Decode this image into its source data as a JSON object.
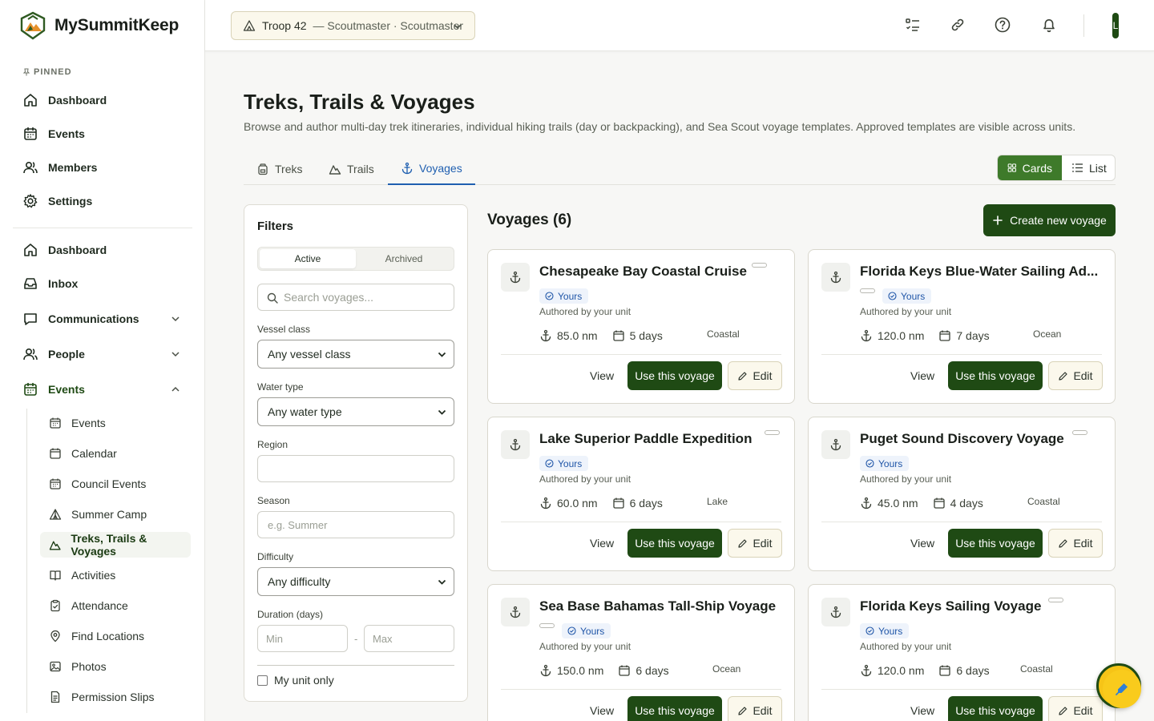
{
  "brand": {
    "name": "MySummitKeep"
  },
  "sidebar": {
    "pinned_label": "PINNED",
    "pinned": [
      {
        "label": "Dashboard",
        "icon": "home-icon"
      },
      {
        "label": "Events",
        "icon": "calendar-icon"
      },
      {
        "label": "Members",
        "icon": "users-icon"
      },
      {
        "label": "Settings",
        "icon": "gear-icon"
      }
    ],
    "main": [
      {
        "label": "Dashboard",
        "icon": "home-icon"
      },
      {
        "label": "Inbox",
        "icon": "inbox-icon"
      },
      {
        "label": "Communications",
        "icon": "message-icon",
        "expandable": true
      },
      {
        "label": "People",
        "icon": "users-icon",
        "expandable": true
      },
      {
        "label": "Events",
        "icon": "calendar-icon",
        "expanded": true
      }
    ],
    "event_sub": [
      {
        "label": "Events",
        "icon": "calendar-grid-icon"
      },
      {
        "label": "Calendar",
        "icon": "calendar-icon"
      },
      {
        "label": "Council Events",
        "icon": "calendar-grid-icon"
      },
      {
        "label": "Summer Camp",
        "icon": "tent-icon"
      },
      {
        "label": "Treks, Trails & Voyages",
        "icon": "mountain-icon",
        "active": true
      },
      {
        "label": "Activities",
        "icon": "book-icon"
      },
      {
        "label": "Attendance",
        "icon": "clipboard-icon"
      },
      {
        "label": "Find Locations",
        "icon": "map-pin-icon"
      },
      {
        "label": "Photos",
        "icon": "image-icon"
      },
      {
        "label": "Permission Slips",
        "icon": "document-icon"
      }
    ]
  },
  "topbar": {
    "troop_name": "Troop 42",
    "troop_role": "— Scoutmaster · Scoutmaster",
    "avatar_initial": "L"
  },
  "page": {
    "title": "Treks, Trails & Voyages",
    "description": "Browse and author multi-day trek itineraries, individual hiking trails (day or backpacking), and Sea Scout voyage templates. Approved templates are visible across units."
  },
  "tabs": [
    {
      "label": "Treks",
      "icon": "backpack-icon"
    },
    {
      "label": "Trails",
      "icon": "mountain-icon"
    },
    {
      "label": "Voyages",
      "icon": "anchor-icon",
      "active": true
    }
  ],
  "view_toggle": {
    "cards": "Cards",
    "list": "List",
    "selected": "Cards"
  },
  "filters": {
    "title": "Filters",
    "segment": {
      "active": "Active",
      "archived": "Archived",
      "selected": "Active"
    },
    "search_placeholder": "Search voyages...",
    "vessel_class_label": "Vessel class",
    "vessel_class_value": "Any vessel class",
    "water_type_label": "Water type",
    "water_type_value": "Any water type",
    "region_label": "Region",
    "region_value": "",
    "season_label": "Season",
    "season_placeholder": "e.g. Summer",
    "difficulty_label": "Difficulty",
    "difficulty_value": "Any difficulty",
    "duration_label": "Duration (days)",
    "min_placeholder": "Min",
    "dash": "-",
    "max_placeholder": "Max",
    "my_unit_label": "My unit only"
  },
  "results": {
    "title": "Voyages (6)",
    "create_label": "Create new voyage"
  },
  "card_labels": {
    "yours": "Yours",
    "authored": "Authored by your unit",
    "view": "View",
    "use": "Use this voyage",
    "edit": "Edit"
  },
  "voyages": [
    {
      "title": "Chesapeake Bay Coastal Cruise",
      "distance": "85.0 nm",
      "duration": "5 days",
      "water": "Coastal"
    },
    {
      "title": "Florida Keys Blue-Water Sailing Ad...",
      "distance": "120.0 nm",
      "duration": "7 days",
      "water": "Ocean"
    },
    {
      "title": "Lake Superior Paddle Expedition",
      "distance": "60.0 nm",
      "duration": "6 days",
      "water": "Lake"
    },
    {
      "title": "Puget Sound Discovery Voyage",
      "distance": "45.0 nm",
      "duration": "4 days",
      "water": "Coastal"
    },
    {
      "title": "Sea Base Bahamas Tall-Ship Voyage",
      "distance": "150.0 nm",
      "duration": "6 days",
      "water": "Ocean"
    },
    {
      "title": "Florida Keys Sailing Voyage",
      "distance": "120.0 nm",
      "duration": "6 days",
      "water": "Coastal"
    }
  ],
  "colors": {
    "primary": "#1f4a14",
    "accent_blue": "#1f5fb0",
    "badge_bg": "#eef3fb",
    "fab": "#f9cb1c"
  }
}
